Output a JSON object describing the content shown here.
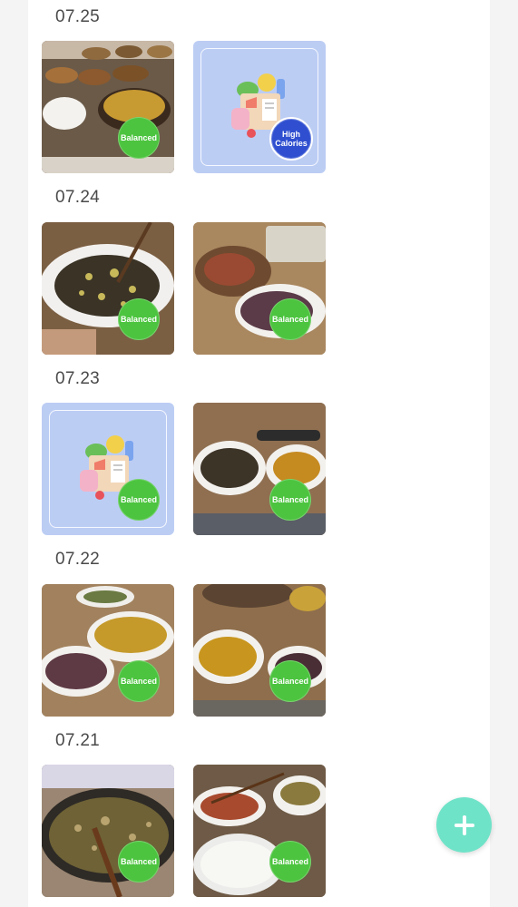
{
  "days": [
    {
      "date": "07.25",
      "meals": [
        {
          "kind": "photo",
          "badge": "Balanced",
          "icon": "meal-photo-icon"
        },
        {
          "kind": "illustration",
          "badge": "High Calories",
          "icon": "grocery-bag-icon"
        }
      ]
    },
    {
      "date": "07.24",
      "meals": [
        {
          "kind": "photo",
          "badge": "Balanced",
          "icon": "meal-photo-icon"
        },
        {
          "kind": "photo",
          "badge": "Balanced",
          "icon": "meal-photo-icon"
        }
      ]
    },
    {
      "date": "07.23",
      "meals": [
        {
          "kind": "illustration",
          "badge": "Balanced",
          "icon": "grocery-bag-icon"
        },
        {
          "kind": "photo",
          "badge": "Balanced",
          "icon": "meal-photo-icon"
        }
      ]
    },
    {
      "date": "07.22",
      "meals": [
        {
          "kind": "photo",
          "badge": "Balanced",
          "icon": "meal-photo-icon"
        },
        {
          "kind": "photo",
          "badge": "Balanced",
          "icon": "meal-photo-icon"
        }
      ]
    },
    {
      "date": "07.21",
      "meals": [
        {
          "kind": "photo",
          "badge": "Balanced",
          "icon": "meal-photo-icon"
        },
        {
          "kind": "photo",
          "badge": "Balanced",
          "icon": "meal-photo-icon"
        }
      ]
    }
  ],
  "fab": {
    "icon": "plus-icon",
    "color": "#6fe3c8"
  },
  "colors": {
    "balanced_badge": "#4cc43f",
    "high_calories_badge": "#2f4fd0",
    "illustration_bg": "#bccdf4"
  }
}
